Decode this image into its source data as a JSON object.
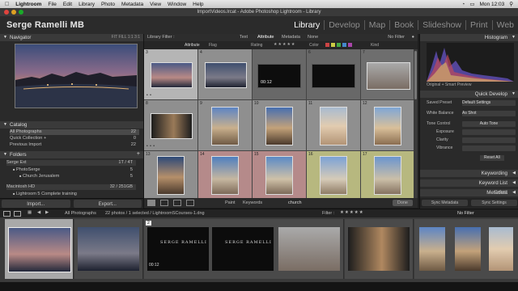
{
  "menubar": {
    "items": [
      "Lightroom",
      "File",
      "Edit",
      "Library",
      "Photo",
      "Metadata",
      "View",
      "Window",
      "Help"
    ],
    "right_text": "Mon 12:03"
  },
  "window": {
    "title": "ImportVideos.lrcat - Adobe Photoshop Lightroom - Library"
  },
  "identity": {
    "name": "Serge Ramelli MB"
  },
  "modules": [
    "Library",
    "Develop",
    "Map",
    "Book",
    "Slideshow",
    "Print",
    "Web"
  ],
  "active_module": "Library",
  "left": {
    "navigator": {
      "title": "Navigator",
      "zoom": [
        "FIT",
        "FILL",
        "1:1",
        "3:1"
      ]
    },
    "catalog": {
      "title": "Catalog",
      "items": [
        {
          "label": "All Photographs",
          "count": "22"
        },
        {
          "label": "Quick Collection +",
          "count": "0"
        },
        {
          "label": "Previous Import",
          "count": "22"
        }
      ]
    },
    "folders": {
      "title": "Folders",
      "volumes": [
        {
          "label": "Serge Ext",
          "info": "1T / 4T"
        },
        {
          "label": "Macintosh HD",
          "info": "32 / 251GB"
        }
      ],
      "items": [
        {
          "label": "PhotoSerge",
          "count": "5"
        },
        {
          "label": "Church Jerusalem",
          "count": "5"
        },
        {
          "label": "Lightroom 5 Complete training",
          "count": ""
        }
      ]
    },
    "import_label": "Import...",
    "export_label": "Export..."
  },
  "center": {
    "filter_title": "Library Filter :",
    "filter_tabs": [
      "Text",
      "Attribute",
      "Metadata",
      "None"
    ],
    "filter_preset": "No Filter",
    "attr_label": "Attribute",
    "attr_flag": "Flag",
    "attr_rating": "Rating",
    "attr_color": "Color",
    "attr_kind": "Kind",
    "toolbar": {
      "painter": "Paint",
      "keywords": "Keywords",
      "keyword_value": "church",
      "done": "Done"
    },
    "cells": [
      {
        "num": "3",
        "kind": "photo",
        "selected": false
      },
      {
        "num": "4",
        "kind": "photo",
        "selected": false
      },
      {
        "num": "5",
        "kind": "video",
        "video_time": "00:12"
      },
      {
        "num": "6",
        "kind": "video",
        "video_time": ""
      },
      {
        "num": "7",
        "kind": "photo"
      },
      {
        "num": "8",
        "kind": "photo"
      },
      {
        "num": "9",
        "kind": "photo"
      },
      {
        "num": "10",
        "kind": "photo"
      },
      {
        "num": "11",
        "kind": "photo"
      },
      {
        "num": "12",
        "kind": "photo"
      },
      {
        "num": "13",
        "kind": "photo"
      },
      {
        "num": "14",
        "kind": "photo"
      },
      {
        "num": "15",
        "kind": "photo"
      },
      {
        "num": "16",
        "kind": "photo"
      },
      {
        "num": "17",
        "kind": "photo"
      }
    ]
  },
  "right": {
    "histogram": {
      "title": "Histogram",
      "info": "Original + Smart Preview"
    },
    "quick_develop": {
      "title": "Quick Develop",
      "saved_preset_label": "Saved Preset",
      "saved_preset_value": "Default Settings",
      "white_balance_label": "White Balance",
      "white_balance_value": "As Shot",
      "tone_control_label": "Tone Control",
      "auto_tone": "Auto Tone",
      "exposure_label": "Exposure",
      "clarity_label": "Clarity",
      "vibrance_label": "Vibrance",
      "reset": "Reset All"
    },
    "keywording": "Keywording",
    "keyword_list": "Keyword List",
    "metadata": "Metadata",
    "metadata_preset": "Default",
    "sync_metadata": "Sync Metadata",
    "sync_settings": "Sync Settings"
  },
  "filmstrip": {
    "source_label": "All Photographs",
    "info": "22 photos / 1 selected / LightroomSCourses-1.dng",
    "filter_label": "Filter :",
    "filter_value": "No Filter",
    "video_brand": "SERGE RAMELLI",
    "video_time": "00:12",
    "badge_num": "2"
  },
  "colors": {
    "accent_active": "#ffffff",
    "panel_bg": "#2a2a2a",
    "grid_bg": "#5a5a5a",
    "label_red": "#b58a8a",
    "label_yellow": "#b7b87f"
  }
}
